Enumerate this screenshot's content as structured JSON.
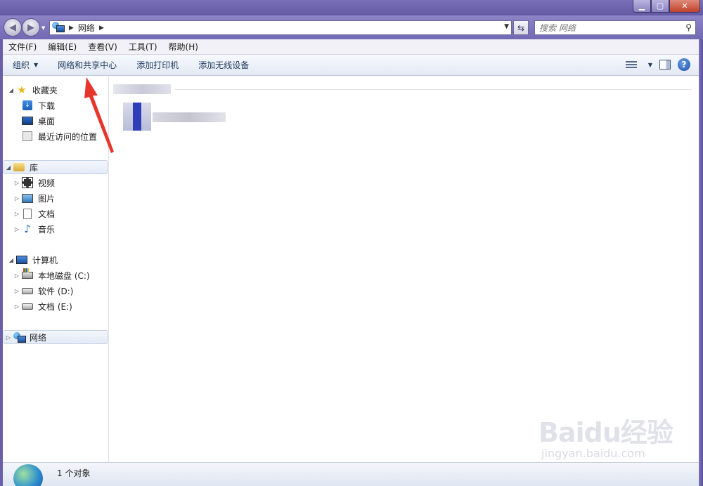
{
  "address_bar": {
    "path": "网络",
    "search_placeholder": "搜索 网络"
  },
  "menu": {
    "items": [
      "文件(F)",
      "编辑(E)",
      "查看(V)",
      "工具(T)",
      "帮助(H)"
    ]
  },
  "commands": {
    "organize": "组织",
    "network_center": "网络和共享中心",
    "add_printer": "添加打印机",
    "add_wireless": "添加无线设备"
  },
  "nav": {
    "favorites": "收藏夹",
    "downloads": "下载",
    "desktop": "桌面",
    "recent": "最近访问的位置",
    "libraries": "库",
    "videos": "视频",
    "pictures": "图片",
    "documents": "文档",
    "music": "音乐",
    "computer": "计算机",
    "drive_c": "本地磁盘 (C:)",
    "drive_d": "软件 (D:)",
    "drive_e": "文档 (E:)",
    "network": "网络"
  },
  "status": {
    "text": "1 个对象"
  },
  "watermark": {
    "main": "Baidu经验",
    "sub": "jingyan.baidu.com"
  }
}
